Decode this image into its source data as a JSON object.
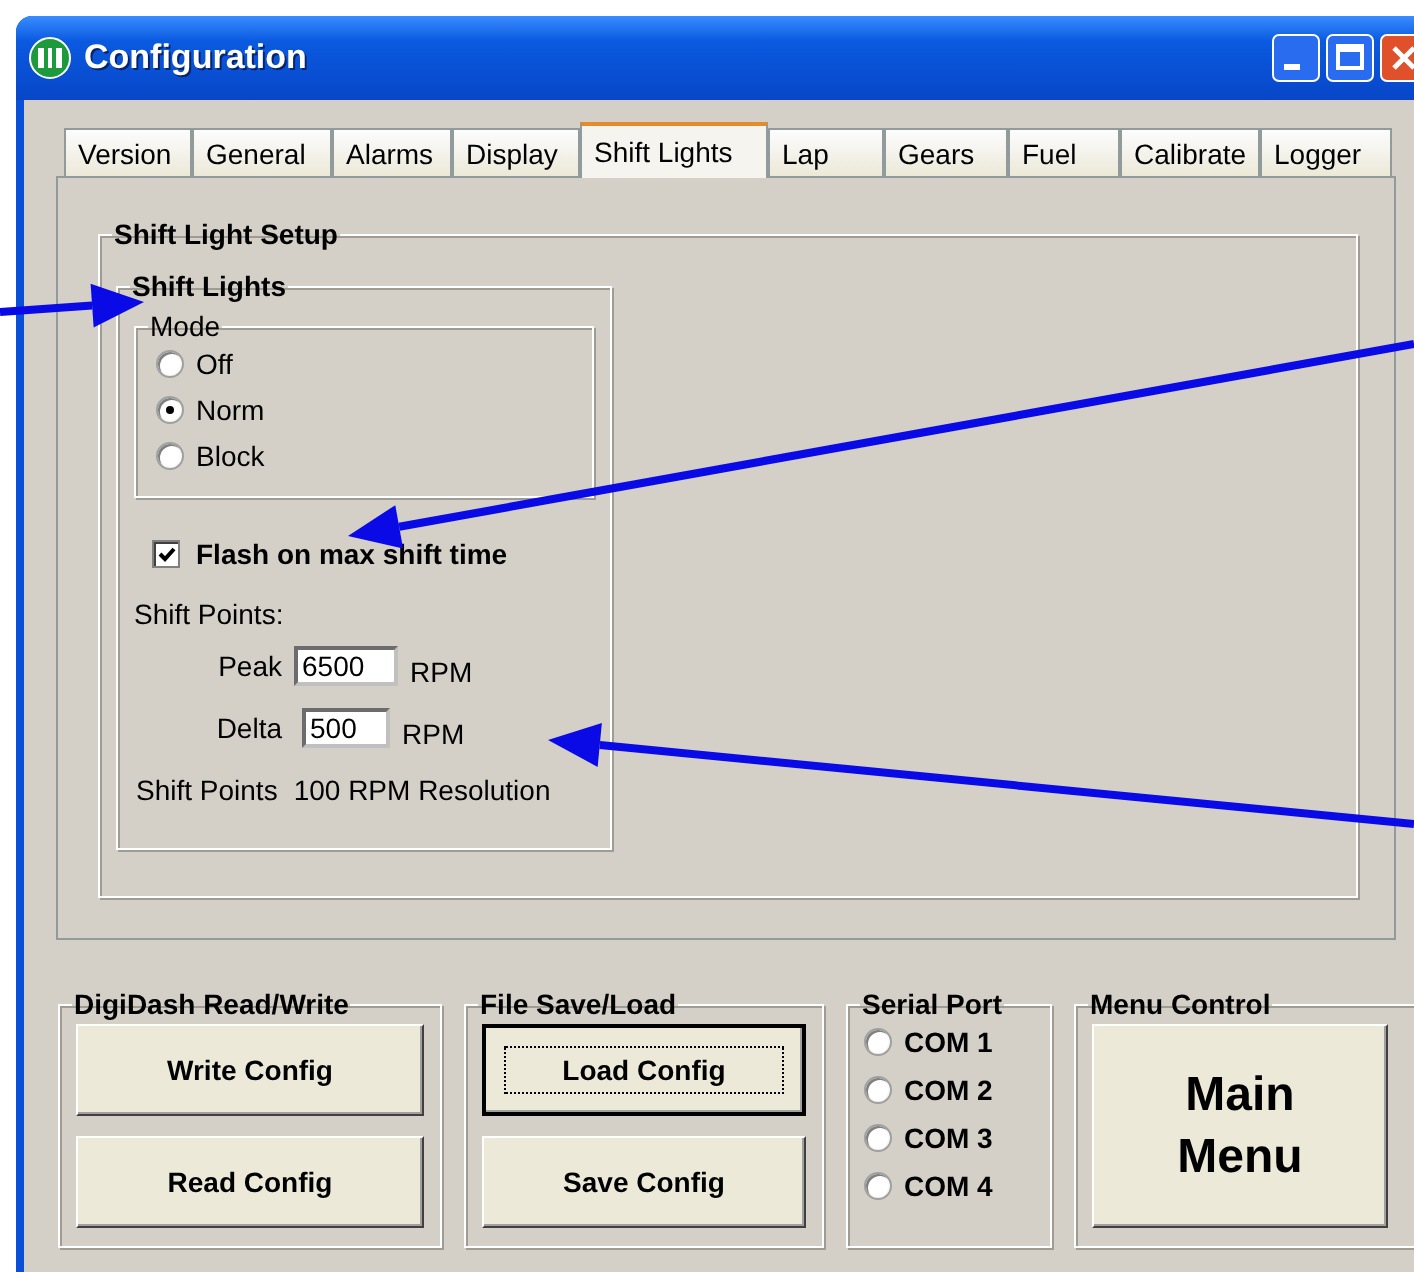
{
  "window": {
    "title": "Configuration"
  },
  "tabs": [
    {
      "label": "Version",
      "selected": false
    },
    {
      "label": "General",
      "selected": false
    },
    {
      "label": "Alarms",
      "selected": false
    },
    {
      "label": "Display",
      "selected": false
    },
    {
      "label": "Shift Lights",
      "selected": true
    },
    {
      "label": "Lap",
      "selected": false
    },
    {
      "label": "Gears",
      "selected": false
    },
    {
      "label": "Fuel",
      "selected": false
    },
    {
      "label": "Calibrate",
      "selected": false
    },
    {
      "label": "Logger",
      "selected": false
    }
  ],
  "shift_light_setup": {
    "title": "Shift Light Setup",
    "shift_lights": {
      "title": "Shift Lights",
      "mode": {
        "title": "Mode",
        "options": [
          {
            "label": "Off",
            "selected": false
          },
          {
            "label": "Norm",
            "selected": true
          },
          {
            "label": "Block",
            "selected": false
          }
        ]
      },
      "flash": {
        "label": "Flash on max shift time",
        "checked": true
      },
      "shift_points_label": "Shift Points:",
      "fields": [
        {
          "label": "Peak",
          "value": "6500",
          "unit": "RPM"
        },
        {
          "label": "Delta",
          "value": "500",
          "unit": "RPM"
        }
      ],
      "resolution_note": [
        "Shift Points",
        "100 RPM Resolution"
      ]
    }
  },
  "digidash": {
    "title": "DigiDash Read/Write",
    "buttons": [
      {
        "label": "Write Config",
        "focused": false
      },
      {
        "label": "Read Config",
        "focused": false
      }
    ]
  },
  "file": {
    "title": "File Save/Load",
    "buttons": [
      {
        "label": "Load Config",
        "focused": true
      },
      {
        "label": "Save Config",
        "focused": false
      }
    ]
  },
  "serial_port": {
    "title": "Serial Port",
    "ports": [
      {
        "label": "COM 1",
        "selected": false
      },
      {
        "label": "COM 2",
        "selected": false
      },
      {
        "label": "COM 3",
        "selected": false
      },
      {
        "label": "COM 4",
        "selected": false
      }
    ]
  },
  "menu_control": {
    "title": "Menu Control",
    "button": "Main Menu"
  }
}
